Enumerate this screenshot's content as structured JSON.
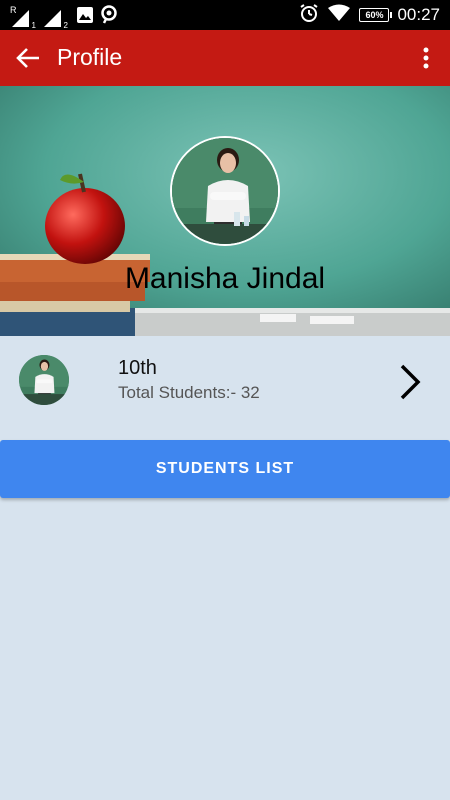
{
  "status_bar": {
    "time": "00:27",
    "battery": "60%",
    "sim1_label": "R",
    "sim1_index": "1",
    "sim2_index": "2"
  },
  "app_bar": {
    "title": "Profile"
  },
  "profile": {
    "name": "Manisha Jindal"
  },
  "class_card": {
    "class_name": "10th",
    "total_students": "Total Students:- 32"
  },
  "actions": {
    "students_list_label": "STUDENTS LIST"
  },
  "colors": {
    "app_bar": "#c41a13",
    "button": "#3f86ef",
    "background": "#d7e3ee"
  }
}
